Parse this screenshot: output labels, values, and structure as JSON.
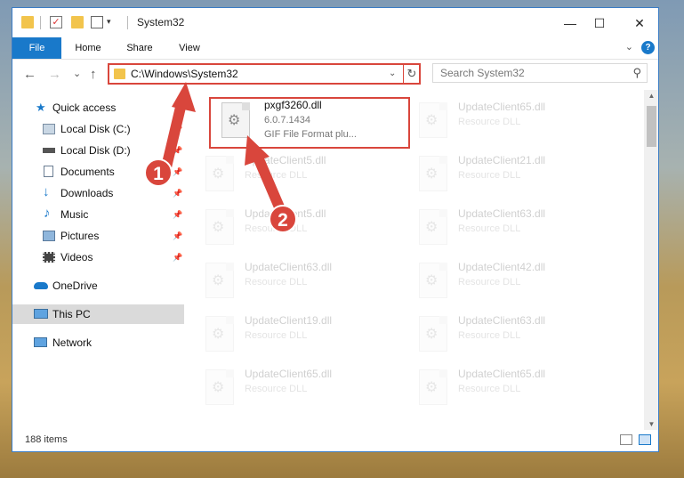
{
  "window": {
    "title": "System32",
    "controls": {
      "minimize": "—",
      "maximize": "☐",
      "close": "✕"
    }
  },
  "ribbon": {
    "tabs": [
      {
        "label": "File"
      },
      {
        "label": "Home"
      },
      {
        "label": "Share"
      },
      {
        "label": "View"
      }
    ],
    "help": "?"
  },
  "navigation": {
    "back": "←",
    "forward": "→",
    "recent": "⌄",
    "up": "↑",
    "address": "C:\\Windows\\System32",
    "refresh": "↻",
    "search_placeholder": "Search System32"
  },
  "sidebar": {
    "items": [
      {
        "label": "Quick access"
      },
      {
        "label": "Local Disk (C:)"
      },
      {
        "label": "Local Disk (D:)"
      },
      {
        "label": "Documents"
      },
      {
        "label": "Downloads"
      },
      {
        "label": "Music"
      },
      {
        "label": "Pictures"
      },
      {
        "label": "Videos"
      },
      {
        "label": "OneDrive"
      },
      {
        "label": "This PC"
      },
      {
        "label": "Network"
      }
    ]
  },
  "files": {
    "highlighted": {
      "name": "pxgf3260.dll",
      "version": "6.0.7.1434",
      "description": "GIF File Format plu..."
    },
    "faded": [
      {
        "name": "UpdateClient65.dll",
        "type": "Resource DLL"
      },
      {
        "name": "UpdateClient5.dll",
        "type": "Resource DLL"
      },
      {
        "name": "UpdateClient21.dll",
        "type": "Resource DLL"
      },
      {
        "name": "UpdateClient5.dll",
        "type": "Resource DLL"
      },
      {
        "name": "UpdateClient63.dll",
        "type": "Resource DLL"
      },
      {
        "name": "UpdateClient63.dll",
        "type": "Resource DLL"
      },
      {
        "name": "UpdateClient42.dll",
        "type": "Resource DLL"
      },
      {
        "name": "UpdateClient19.dll",
        "type": "Resource DLL"
      },
      {
        "name": "UpdateClient63.dll",
        "type": "Resource DLL"
      },
      {
        "name": "UpdateClient65.dll",
        "type": "Resource DLL"
      },
      {
        "name": "UpdateClient65.dll",
        "type": "Resource DLL"
      }
    ]
  },
  "status": {
    "item_count": "188 items"
  },
  "callouts": {
    "one": "1",
    "two": "2"
  },
  "colors": {
    "accent": "#1979ca",
    "callout": "#d9463c",
    "folder": "#f2c44c"
  }
}
